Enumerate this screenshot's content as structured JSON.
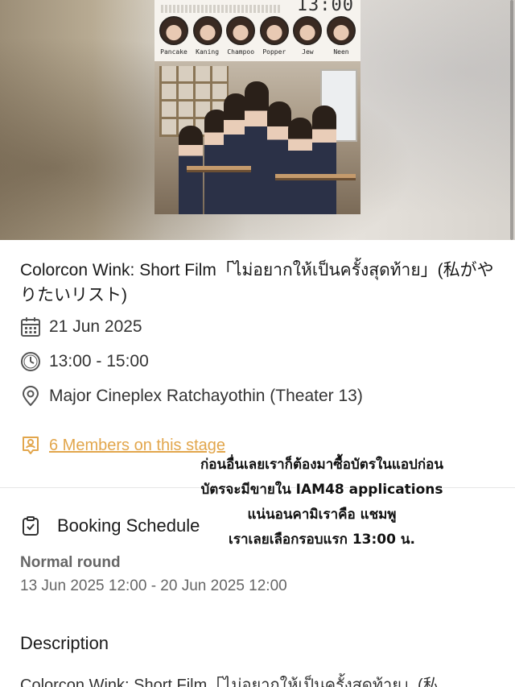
{
  "poster": {
    "time_fragment": "13:00",
    "members": [
      "Pancake",
      "Kaning",
      "Champoo",
      "Popper",
      "Jew",
      "Neen"
    ]
  },
  "event": {
    "title": "Colorcon Wink: Short Film「ไม่อยากให้เป็นครั้งสุดท้าย」(私がやりたいリスト)",
    "date": "21 Jun 2025",
    "time": "13:00 - 15:00",
    "venue": "Major Cineplex Ratchayothin (Theater 13)",
    "members_link": "6 Members on this stage"
  },
  "overlay_caption": [
    "ก่อนอื่นเลยเราก็ต้องมาซื้อบัตรในแอปก่อน",
    "บัตรจะมีขายใน IAM48 applications",
    "แน่นอนคามิเราคือ แชมพู",
    "เราเลยเลือกรอบแรก 13:00 น."
  ],
  "booking": {
    "heading": "Booking Schedule",
    "round_label": "Normal round",
    "round_dates": "13 Jun 2025 12:00 - 20 Jun 2025 12:00"
  },
  "description": {
    "heading": "Description",
    "text": "Colorcon Wink: Short Film「ไม่อยากให้เป็นครั้งสุดท้าย」(私"
  },
  "colors": {
    "accent": "#e2a64c",
    "text": "#1a1a1a",
    "muted": "#666666"
  }
}
